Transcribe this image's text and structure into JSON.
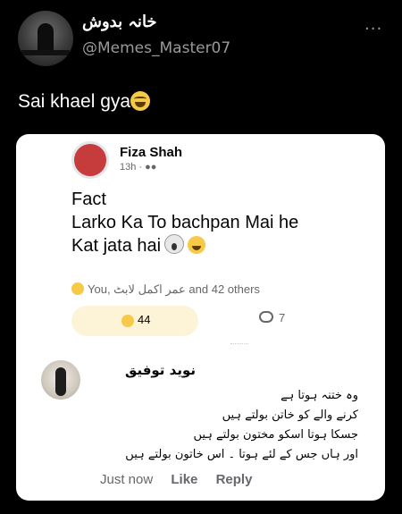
{
  "tweet": {
    "display_name": "خانہ بدوش",
    "handle": "@Memes_Master07",
    "more_label": "···",
    "text": "Sai khael gya",
    "text_emoji": "laughing-tears-icon"
  },
  "post": {
    "author": "Fiza Shah",
    "time": "13h",
    "audience_icon": "friends-icon",
    "lines": [
      "Fact",
      "Larko Ka To bachpan Mai he",
      "Kat jata hai"
    ],
    "reactions_summary": "You, عمر اکمل لابٹ and 42 others",
    "reaction_count": "44",
    "comment_count": "7"
  },
  "comment": {
    "author": "نوید توفیق",
    "lines": [
      "وہ ختنہ ہوتا ہے",
      "کرنے والے کو خاتن بولتے ہیں",
      "جسکا ہوتا اسکو مختون بولتے ہیں",
      "اور ہاں جس کے لئے ہوتا ۔ اس خاتون بولتے ہیں"
    ],
    "time": "Just now",
    "like_label": "Like",
    "reply_label": "Reply"
  },
  "colors": {
    "background": "#000000",
    "card": "#ffffff",
    "muted": "#65676b",
    "handle": "#9a9a9a",
    "reaction_pill": "#fdf4d8"
  }
}
